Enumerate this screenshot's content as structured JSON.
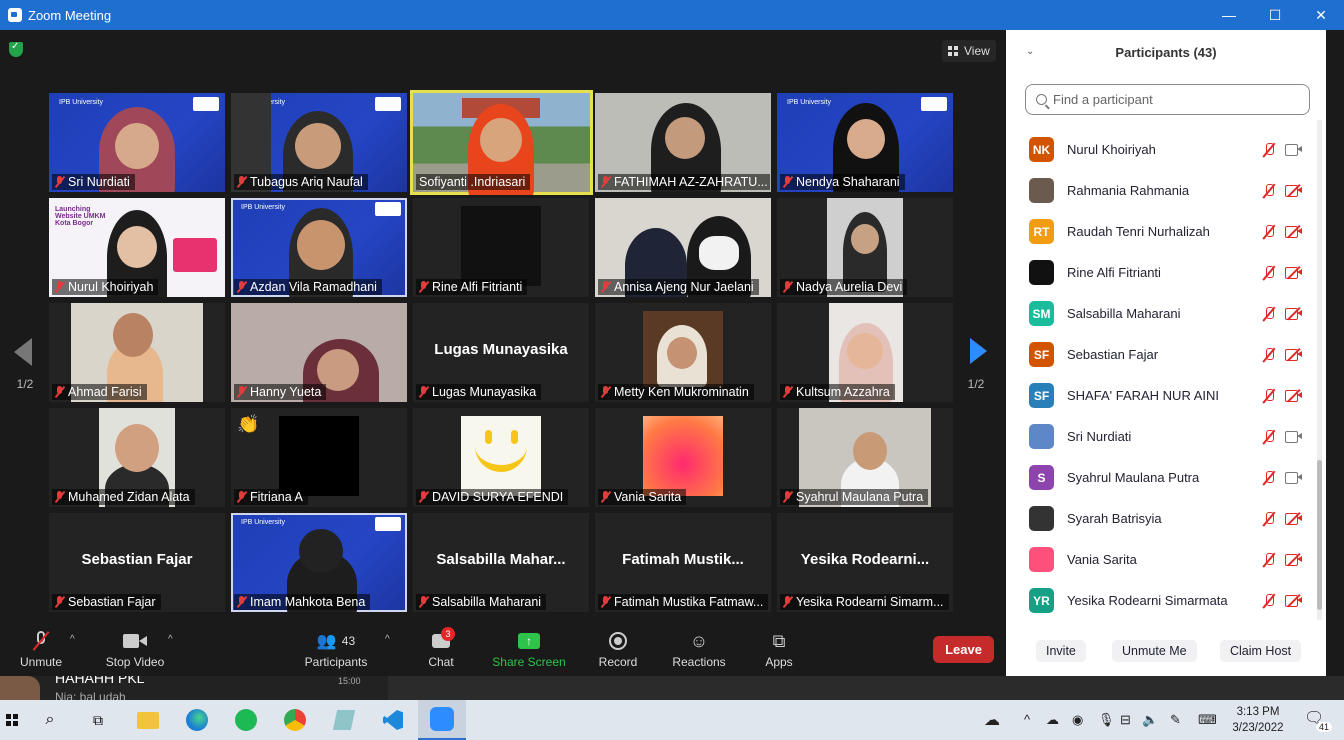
{
  "window": {
    "title": "Zoom Meeting",
    "minimize": "—",
    "maximize": "☐",
    "close": "✕"
  },
  "view_label": "View",
  "page_indicator_left": "1/2",
  "page_indicator_right": "1/2",
  "tiles": [
    {
      "name": "Sri Nurdiati"
    },
    {
      "name": "Tubagus Ariq Naufal"
    },
    {
      "name": "Sofiyanti .Indriasari"
    },
    {
      "name": "FATHIMAH AZ-ZAHRATU..."
    },
    {
      "name": "Nendya Shaharani"
    },
    {
      "name": "Nurul Khoiriyah"
    },
    {
      "name": "Azdan Vila Ramadhani"
    },
    {
      "name": "Rine Alfi Fitrianti"
    },
    {
      "name": "Annisa Ajeng Nur Jaelani"
    },
    {
      "name": "Nadya Aurelia Devi"
    },
    {
      "name": "Ahmad Farisi"
    },
    {
      "name": "Hanny Yueta"
    },
    {
      "name": "Lugas Munayasika",
      "display": "Lugas Munayasika"
    },
    {
      "name": "Metty Ken Mukrominatin"
    },
    {
      "name": "Kultsum Azzahra"
    },
    {
      "name": "Muhamed Zidan Alata"
    },
    {
      "name": "Fitriana A"
    },
    {
      "name": "DAVID SURYA EFENDI"
    },
    {
      "name": "Vania Sarita"
    },
    {
      "name": "Syahrul Maulana Putra"
    },
    {
      "name": "Sebastian Fajar",
      "display": "Sebastian Fajar"
    },
    {
      "name": "Imam Mahkota Bena"
    },
    {
      "name": "Salsabilla Maharani",
      "display": "Salsabilla  Mahar..."
    },
    {
      "name": "Fatimah Mustika Fatmaw...",
      "display": "Fatimah  Mustik..."
    },
    {
      "name": "Yesika Rodearni Simarm...",
      "display": "Yesika  Rodearni..."
    }
  ],
  "toolbar": {
    "unmute": "Unmute",
    "stop_video": "Stop Video",
    "participants": "Participants",
    "participants_count": "43",
    "chat": "Chat",
    "chat_badge": "3",
    "share_screen": "Share Screen",
    "record": "Record",
    "reactions": "Reactions",
    "apps": "Apps",
    "leave": "Leave"
  },
  "panel": {
    "title": "Participants (43)",
    "search_placeholder": "Find a participant",
    "participants": [
      {
        "name": "Nurul Khoiriyah",
        "initials": "NK",
        "color": "#d35400",
        "video": true
      },
      {
        "name": "Rahmania Rahmania",
        "initials": "",
        "color": "#6b5a4e",
        "video": false
      },
      {
        "name": "Raudah Tenri Nurhalizah",
        "initials": "RT",
        "color": "#f39c12",
        "video": false
      },
      {
        "name": "Rine Alfi Fitrianti",
        "initials": "",
        "color": "#111111",
        "video": false
      },
      {
        "name": "Salsabilla Maharani",
        "initials": "SM",
        "color": "#1abc9c",
        "video": false
      },
      {
        "name": "Sebastian Fajar",
        "initials": "SF",
        "color": "#d35400",
        "video": false
      },
      {
        "name": "SHAFA' FARAH NUR AINI",
        "initials": "SF",
        "color": "#2980b9",
        "video": false
      },
      {
        "name": "Sri Nurdiati",
        "initials": "",
        "color": "#5d87c7",
        "video": true
      },
      {
        "name": "Syahrul Maulana Putra",
        "initials": "S",
        "color": "#8e44ad",
        "video": true
      },
      {
        "name": "Syarah Batrisyia",
        "initials": "",
        "color": "#333333",
        "video": false
      },
      {
        "name": "Vania Sarita",
        "initials": "",
        "color": "#ff4f7b",
        "video": false
      },
      {
        "name": "Yesika Rodearni Simarmata",
        "initials": "YR",
        "color": "#16a085",
        "video": false
      }
    ],
    "invite": "Invite",
    "unmute_me": "Unmute Me",
    "claim_host": "Claim Host"
  },
  "background_chat": {
    "line1": "HAHAHH PKL",
    "line2": "Nia: bal udah",
    "time": "15:00"
  },
  "taskbar": {
    "time": "3:13 PM",
    "date": "3/23/2022",
    "notifications": "41"
  }
}
